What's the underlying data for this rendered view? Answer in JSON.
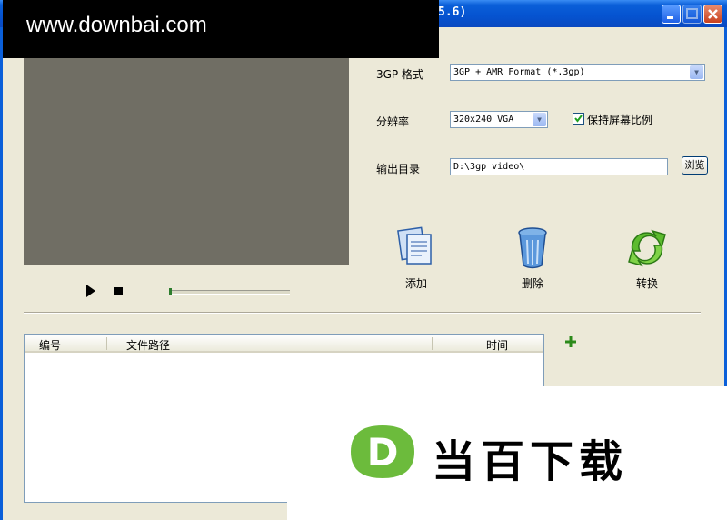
{
  "window": {
    "title": "5.6)",
    "minimize_icon": "minimize-icon",
    "maximize_icon": "maximize-icon",
    "close_icon": "close-icon"
  },
  "watermark": {
    "top_text": "www.downbai.com",
    "logo_text": "当百下载",
    "logo_letter": "D"
  },
  "form": {
    "format_label": "3GP 格式",
    "format_value": "3GP + AMR Format (*.3gp)",
    "resolution_label": "分辨率",
    "resolution_value": "320x240 VGA",
    "keep_ratio_label": "保持屏幕比例",
    "keep_ratio_checked": true,
    "output_label": "输出目录",
    "output_value": "D:\\3gp video\\",
    "browse_label": "浏览"
  },
  "actions": {
    "add_label": "添加",
    "delete_label": "删除",
    "convert_label": "转换"
  },
  "player": {
    "progress": 0
  },
  "list": {
    "columns": [
      "编号",
      "文件路径",
      "时间"
    ],
    "rows": []
  },
  "colors": {
    "titlebar": "#0553d0",
    "preview": "#706e64",
    "window_bg": "#ece9d8",
    "accent_green": "#6cbb3c"
  }
}
